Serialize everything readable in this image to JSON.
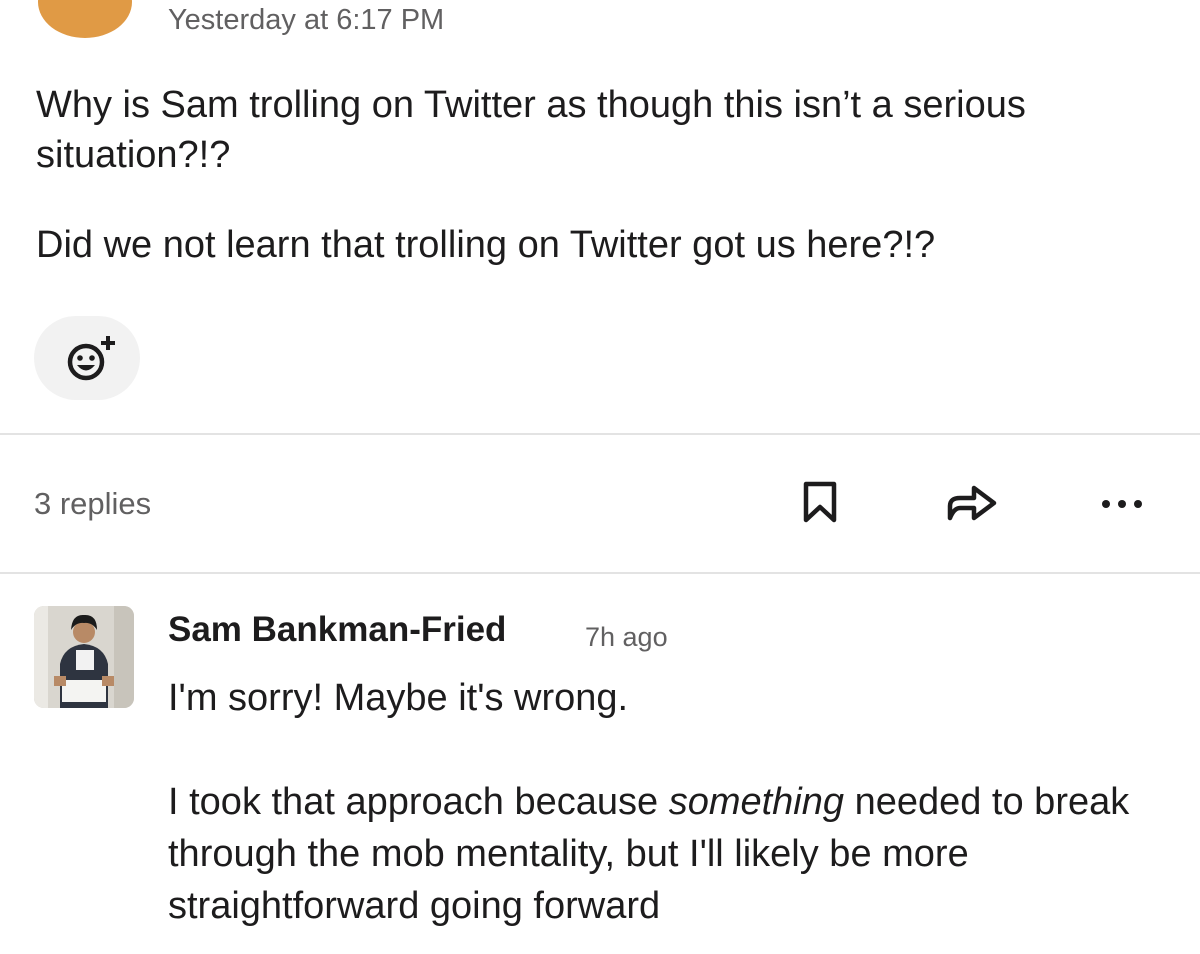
{
  "message": {
    "timestamp": "Yesterday at 6:17 PM",
    "paragraph_1": "Why is Sam trolling on Twitter as though this isn’t a serious situation?!?",
    "paragraph_2": "Did we not learn that trolling on Twitter got us here?!?",
    "reaction_icon": "add-reaction-icon",
    "avatar_color": "#e09a45"
  },
  "thread_bar": {
    "replies_label": "3 replies",
    "icons": [
      "bookmark-icon",
      "share-icon",
      "more-icon"
    ]
  },
  "reply": {
    "author": "Sam Bankman-Fried",
    "time": "7h ago",
    "paragraph_1": "I'm sorry!  Maybe it's wrong.",
    "paragraph_2_before": "I took that approach because ",
    "paragraph_2_emphasis": "something",
    "paragraph_2_after": " needed to break through the mob mentality, but I'll likely be more straightforward going forward"
  },
  "colors": {
    "text": "#1d1c1d",
    "muted": "#616061",
    "divider": "#e3e3e3",
    "reaction_bg": "#f2f2f2"
  }
}
